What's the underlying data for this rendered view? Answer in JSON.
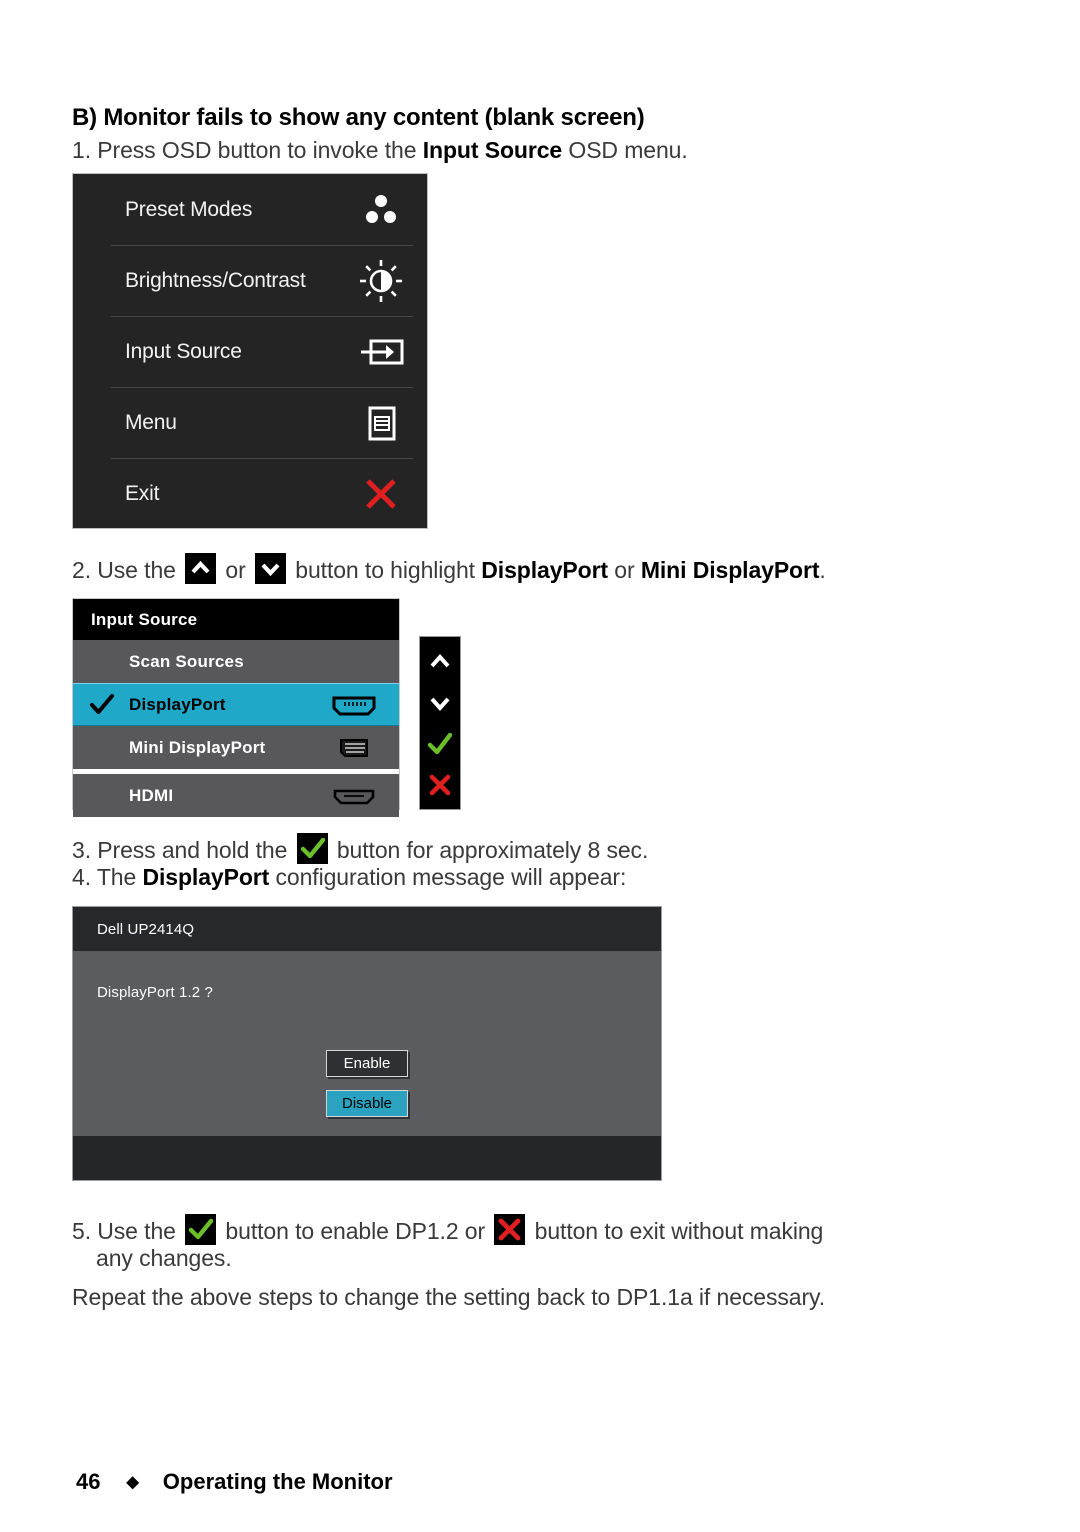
{
  "heading": "B) Monitor fails to show any content (blank screen)",
  "steps": {
    "s1_a": "1. Press OSD button to invoke the ",
    "s1_b": "Input Source",
    "s1_c": " OSD menu.",
    "s2_a": "2. Use the ",
    "s2_b": " or ",
    "s2_c": " button to highlight ",
    "s2_d": "DisplayPort",
    "s2_e": " or ",
    "s2_f": "Mini DisplayPort",
    "s2_g": ".",
    "s3_a": "3. Press and hold the ",
    "s3_b": " button for approximately 8 sec.",
    "s4_a": "4. The ",
    "s4_b": "DisplayPort",
    "s4_c": " configuration message will appear:",
    "s5_a": "5. Use the ",
    "s5_b": " button to enable DP1.2 or ",
    "s5_c": " button to exit without making",
    "s5_d": "any changes.",
    "s6": "Repeat the above steps to change the setting back to DP1.1a if necessary."
  },
  "osd_main": {
    "items": [
      {
        "label": "Preset Modes",
        "icon": "preset-modes-icon"
      },
      {
        "label": "Brightness/Contrast",
        "icon": "brightness-contrast-icon"
      },
      {
        "label": "Input Source",
        "icon": "input-source-icon"
      },
      {
        "label": "Menu",
        "icon": "menu-icon"
      },
      {
        "label": "Exit",
        "icon": "exit-x-icon"
      }
    ]
  },
  "osd_input": {
    "title": "Input Source",
    "items": [
      {
        "label": "Scan Sources",
        "selected": false,
        "checked": false,
        "port": "none"
      },
      {
        "label": "DisplayPort",
        "selected": true,
        "checked": true,
        "port": "displayport"
      },
      {
        "label": "Mini DisplayPort",
        "selected": false,
        "checked": false,
        "port": "mini-displayport"
      },
      {
        "label": "HDMI",
        "selected": false,
        "checked": false,
        "port": "hdmi"
      }
    ],
    "side_keys": [
      "up-chevron-icon",
      "down-chevron-icon",
      "check-icon",
      "close-x-icon"
    ]
  },
  "dialog": {
    "title": "Dell UP2414Q",
    "message": "DisplayPort 1.2 ?",
    "enable_label": "Enable",
    "disable_label": "Disable"
  },
  "footer": {
    "page_number": "46",
    "diamond": "◆",
    "section": "Operating the Monitor"
  },
  "colors": {
    "highlight_cyan": "#1fa8c8",
    "osd_row_gray": "#58585a",
    "osd_dark": "#242425",
    "dialog_gray": "#5a5c60",
    "red_x": "#e02020",
    "green_check": "#6abf2a"
  }
}
